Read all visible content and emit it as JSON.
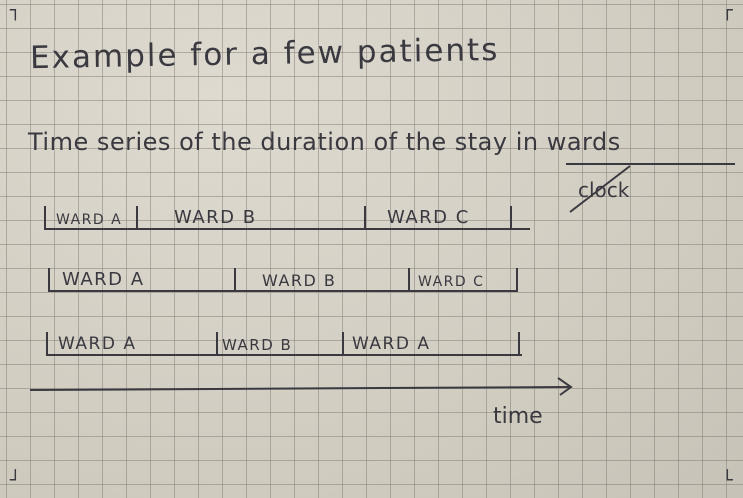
{
  "title": "Example for a few patients",
  "subtitle": "Time series of the duration of the stay in wards",
  "annotation": "clock",
  "axis_label": "time",
  "rows": [
    {
      "segments": [
        "WARD A",
        "WARD B",
        "WARD C"
      ]
    },
    {
      "segments": [
        "WARD A",
        "WARD B",
        "WARD C"
      ]
    },
    {
      "segments": [
        "WARD A",
        "WARD B",
        "WARD A"
      ]
    }
  ]
}
